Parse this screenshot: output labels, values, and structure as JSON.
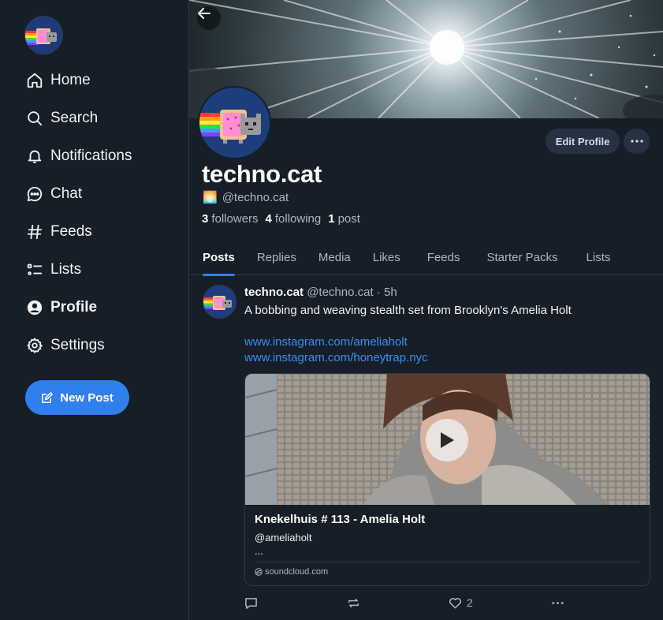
{
  "sidebar": {
    "nav": [
      {
        "label": "Home",
        "icon": "home-icon"
      },
      {
        "label": "Search",
        "icon": "search-icon"
      },
      {
        "label": "Notifications",
        "icon": "bell-icon"
      },
      {
        "label": "Chat",
        "icon": "chat-icon"
      },
      {
        "label": "Feeds",
        "icon": "hash-icon"
      },
      {
        "label": "Lists",
        "icon": "list-icon"
      },
      {
        "label": "Profile",
        "icon": "user-circle-icon",
        "active": true
      },
      {
        "label": "Settings",
        "icon": "gear-icon"
      }
    ],
    "new_post_label": "New Post"
  },
  "profile": {
    "display_name": "techno.cat",
    "emoji": "🌅",
    "handle": "@techno.cat",
    "followers_count": "3",
    "followers_label": "followers",
    "following_count": "4",
    "following_label": "following",
    "posts_count": "1",
    "posts_label": "post",
    "edit_label": "Edit Profile"
  },
  "tabs": [
    {
      "label": "Posts",
      "active": true
    },
    {
      "label": "Replies"
    },
    {
      "label": "Media"
    },
    {
      "label": "Likes"
    },
    {
      "label": "Feeds"
    },
    {
      "label": "Starter Packs"
    },
    {
      "label": "Lists"
    }
  ],
  "post": {
    "author_name": "techno.cat",
    "author_handle": "@techno.cat",
    "time": "· 5h",
    "text": "A bobbing and weaving stealth set from Brooklyn's Amelia Holt",
    "links": [
      "www.instagram.com/ameliaholt",
      "www.instagram.com/honeytrap.nyc"
    ],
    "embed": {
      "title": "Knekelhuis # 113 - Amelia Holt",
      "author": "@ameliaholt",
      "ellipsis": "...",
      "domain": "soundcloud.com"
    },
    "like_count": "2"
  },
  "colors": {
    "background": "#161e27",
    "accent": "#2f80ed",
    "link": "#3b8ef5",
    "muted_text": "#aeb7c2",
    "button_bg": "#263241"
  }
}
